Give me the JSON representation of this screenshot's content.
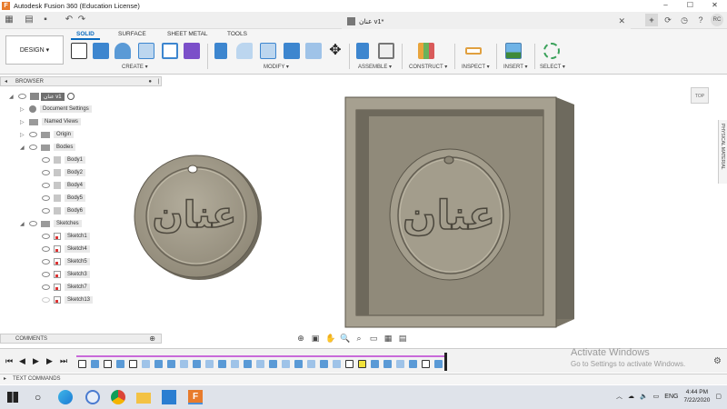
{
  "window": {
    "title": "Autodesk Fusion 360 (Education License)",
    "doc_tab": "عنان v1*",
    "app_icon_letter": "F",
    "avatar": "RC"
  },
  "ribbon": {
    "workspace": "DESIGN",
    "tabs": [
      "SOLID",
      "SURFACE",
      "SHEET METAL",
      "TOOLS"
    ],
    "active_tab": "SOLID",
    "groups": [
      "CREATE",
      "MODIFY",
      "ASSEMBLE",
      "CONSTRUCT",
      "INSPECT",
      "INSERT",
      "SELECT"
    ]
  },
  "browser": {
    "title": "BROWSER",
    "component": "عنان v1",
    "items": [
      {
        "label": "Document Settings",
        "type": "gear"
      },
      {
        "label": "Named Views",
        "type": "folder"
      },
      {
        "label": "Origin",
        "type": "folder"
      },
      {
        "label": "Bodies",
        "type": "folder"
      },
      {
        "label": "Body1",
        "type": "body"
      },
      {
        "label": "Body2",
        "type": "body"
      },
      {
        "label": "Body4",
        "type": "body"
      },
      {
        "label": "Body5",
        "type": "body"
      },
      {
        "label": "Body6",
        "type": "body"
      },
      {
        "label": "Sketches",
        "type": "folder"
      },
      {
        "label": "Sketch1",
        "type": "sketch"
      },
      {
        "label": "Sketch4",
        "type": "sketch"
      },
      {
        "label": "Sketch5",
        "type": "sketch"
      },
      {
        "label": "Sketch3",
        "type": "sketch"
      },
      {
        "label": "Sketch7",
        "type": "sketch"
      },
      {
        "label": "Sketch13",
        "type": "sketch"
      }
    ]
  },
  "viewport": {
    "viewcube_label": "TOP",
    "medallion_text": "عنان",
    "properties_label": "PHYSICAL MATERIAL"
  },
  "comments": {
    "title": "COMMENTS"
  },
  "text_commands": {
    "title": "TEXT COMMANDS"
  },
  "watermark": {
    "line1": "Activate Windows",
    "line2": "Go to Settings to activate Windows."
  },
  "taskbar": {
    "language": "ENG",
    "time": "4:44 PM",
    "date": "7/22/2020"
  },
  "colors": {
    "accent": "#0a6bbf",
    "model": "#a49c8a",
    "timeline_track": "#c96ad9"
  }
}
